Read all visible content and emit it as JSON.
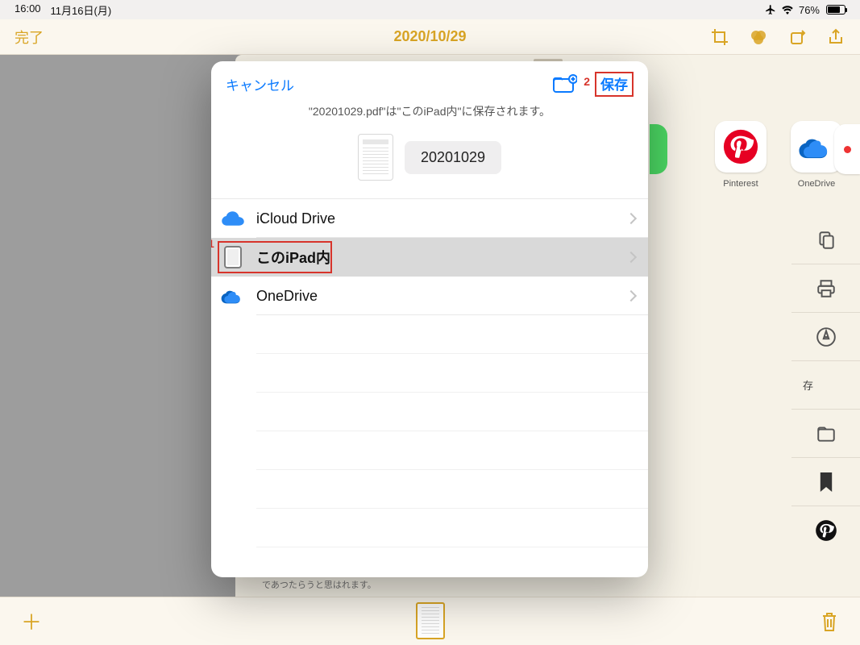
{
  "status": {
    "time": "16:00",
    "date": "11月16日(月)",
    "battery_pct": "76%"
  },
  "nav": {
    "done": "完了",
    "title": "2020/10/29"
  },
  "share_apps": [
    {
      "key": "pinterest",
      "label": "Pinterest"
    },
    {
      "key": "onedrive",
      "label": "OneDrive"
    }
  ],
  "action_col": {
    "save_label": "存"
  },
  "modal": {
    "cancel": "キャンセル",
    "save": "保存",
    "annotation2": "2",
    "message": "\"20201029.pdf\"は\"このiPad内\"に保存されます。",
    "filename": "20201029",
    "annotation1": "1",
    "locations": [
      {
        "key": "icloud",
        "label": "iCloud Drive",
        "selected": false
      },
      {
        "key": "ipad",
        "label": "このiPad内",
        "selected": true
      },
      {
        "key": "onedrive",
        "label": "OneDrive",
        "selected": false
      }
    ]
  },
  "bg_snippet": "郡の聖人が「近頃参に周公を見なくなつた」と云つて歎かれたのも、全く聖人の實感であつたらうと思はれます。"
}
